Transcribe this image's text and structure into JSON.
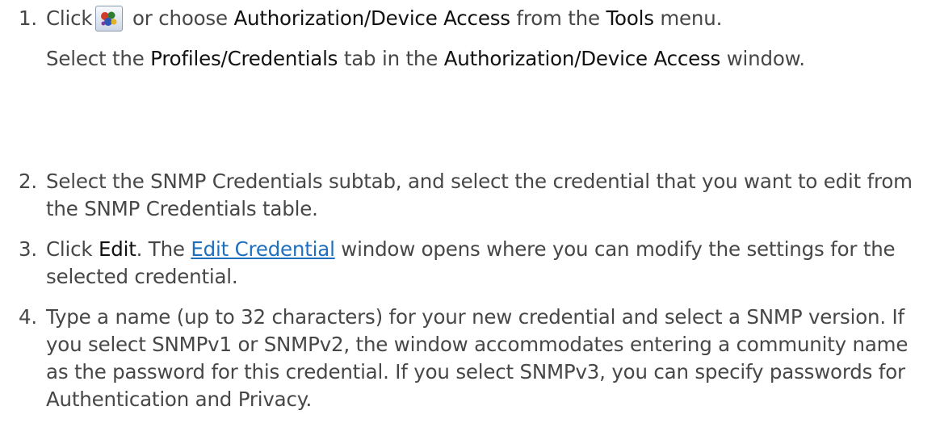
{
  "colors": {
    "text": "#474747",
    "bold_text": "#111111",
    "link": "#1f6fbf"
  },
  "steps": [
    {
      "number": "1.",
      "p1": {
        "t0": "Click",
        "icon": "authorization-device-access-icon",
        "t1": " or choose ",
        "b0": "Authorization/Device Access",
        "t2": " from the ",
        "b1": "Tools",
        "t3": " menu."
      },
      "p2": {
        "t0": "Select the ",
        "b0": "Profiles/Credentials",
        "t1": " tab in the ",
        "b1": "Authorization/Device Access",
        "t2": " window."
      }
    },
    {
      "number": "2.",
      "text": "Select the SNMP Credentials subtab, and select the credential that you want to edit from the SNMP Credentials table."
    },
    {
      "number": "3.",
      "t0": "Click ",
      "b0": "Edit",
      "t1": ". The ",
      "link": "Edit Credential",
      "t2": " window opens where you can modify the settings for the selected credential."
    },
    {
      "number": "4.",
      "text": "Type a name (up to 32 characters) for your new credential and select a SNMP version. If you select SNMPv1 or SNMPv2, the window accommodates entering a community name as the password for this credential. If you select SNMPv3, you can specify passwords for Authentication and Privacy."
    }
  ]
}
